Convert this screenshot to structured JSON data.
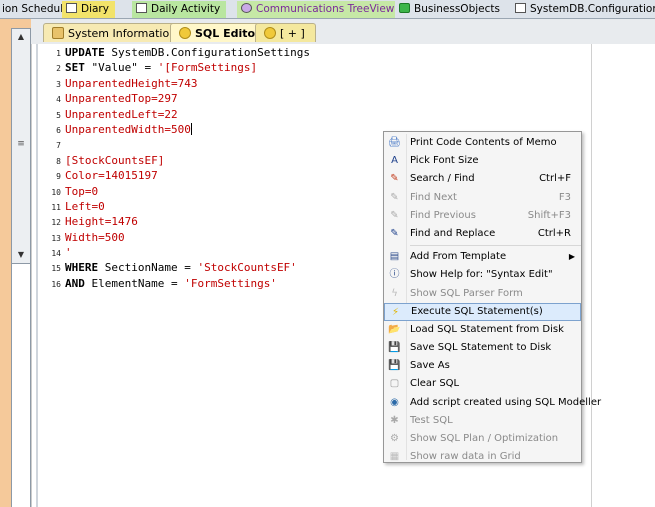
{
  "top_tabs": [
    "ion Scheduler",
    "Diary",
    "Daily Activity",
    "Communications TreeView",
    "BusinessObjects",
    "SystemDB.Configuration"
  ],
  "editor_tabs": [
    "System Information",
    "SQL Editor",
    "[ + ]"
  ],
  "code_lines": [
    {
      "n": "1",
      "parts": [
        {
          "t": "UPDATE",
          "c": "kw"
        },
        {
          "t": " SystemDB.ConfigurationSettings",
          "c": ""
        }
      ]
    },
    {
      "n": "2",
      "parts": [
        {
          "t": "SET",
          "c": "kw"
        },
        {
          "t": " \"Value\" = ",
          "c": ""
        },
        {
          "t": "'[FormSettings]",
          "c": "str"
        }
      ]
    },
    {
      "n": "3",
      "parts": [
        {
          "t": "UnparentedHeight=743",
          "c": "str"
        }
      ]
    },
    {
      "n": "4",
      "parts": [
        {
          "t": "UnparentedTop=297",
          "c": "str"
        }
      ]
    },
    {
      "n": "5",
      "parts": [
        {
          "t": "UnparentedLeft=22",
          "c": "str"
        }
      ]
    },
    {
      "n": "6",
      "parts": [
        {
          "t": "UnparentedWidth=500",
          "c": "str"
        }
      ],
      "cursor": true
    },
    {
      "n": "7",
      "parts": []
    },
    {
      "n": "8",
      "parts": [
        {
          "t": "[StockCountsEF]",
          "c": "str"
        }
      ]
    },
    {
      "n": "9",
      "parts": [
        {
          "t": "Color=14015197",
          "c": "str"
        }
      ]
    },
    {
      "n": "10",
      "parts": [
        {
          "t": "Top=0",
          "c": "str"
        }
      ]
    },
    {
      "n": "11",
      "parts": [
        {
          "t": "Left=0",
          "c": "str"
        }
      ]
    },
    {
      "n": "12",
      "parts": [
        {
          "t": "Height=1476",
          "c": "str"
        }
      ]
    },
    {
      "n": "13",
      "parts": [
        {
          "t": "Width=500",
          "c": "str"
        }
      ]
    },
    {
      "n": "14",
      "parts": [
        {
          "t": "'",
          "c": "str"
        }
      ]
    },
    {
      "n": "15",
      "parts": [
        {
          "t": "WHERE",
          "c": "kw"
        },
        {
          "t": " SectionName = ",
          "c": ""
        },
        {
          "t": "'StockCountsEF'",
          "c": "str"
        }
      ]
    },
    {
      "n": "16",
      "parts": [
        {
          "t": "AND",
          "c": "kw"
        },
        {
          "t": " ElementName = ",
          "c": ""
        },
        {
          "t": "'FormSettings'",
          "c": "str"
        }
      ]
    }
  ],
  "menu_items": [
    {
      "label": "Print Code Contents of Memo",
      "icon": "printer-icon",
      "glyph": "🖨",
      "shortcut": "",
      "disabled": false
    },
    {
      "label": "Pick Font Size",
      "icon": "font-icon",
      "glyph": "A",
      "shortcut": "",
      "disabled": false
    },
    {
      "label": "Search / Find",
      "icon": "search-icon",
      "glyph": "✎",
      "shortcut": "Ctrl+F",
      "disabled": false
    },
    {
      "label": "Find Next",
      "icon": "find-next-icon",
      "glyph": "✎",
      "shortcut": "F3",
      "disabled": true
    },
    {
      "label": "Find Previous",
      "icon": "find-previous-icon",
      "glyph": "✎",
      "shortcut": "Shift+F3",
      "disabled": true
    },
    {
      "label": "Find and Replace",
      "icon": "replace-icon",
      "glyph": "✎",
      "shortcut": "Ctrl+R",
      "disabled": false,
      "sep_after": true
    },
    {
      "label": "Add From Template",
      "icon": "template-icon",
      "glyph": "▤",
      "shortcut": "",
      "submenu": true,
      "disabled": false
    },
    {
      "label": "Show Help for: \"Syntax Edit\"",
      "icon": "help-icon",
      "glyph": "ⓘ",
      "shortcut": "",
      "disabled": false
    },
    {
      "label": "Show SQL Parser Form",
      "icon": "parser-icon",
      "glyph": "ϟ",
      "shortcut": "",
      "disabled": true
    },
    {
      "label": "Execute SQL Statement(s)",
      "icon": "execute-icon",
      "glyph": "⚡",
      "shortcut": "",
      "disabled": false,
      "highlighted": true
    },
    {
      "label": "Load SQL Statement from Disk",
      "icon": "folder-icon",
      "glyph": "📂",
      "shortcut": "",
      "disabled": false
    },
    {
      "label": "Save SQL Statement to Disk",
      "icon": "save-icon",
      "glyph": "💾",
      "shortcut": "",
      "disabled": false
    },
    {
      "label": "Save As",
      "icon": "save-as-icon",
      "glyph": "💾",
      "shortcut": "",
      "disabled": false
    },
    {
      "label": "Clear SQL",
      "icon": "clear-icon",
      "glyph": "▢",
      "shortcut": "",
      "disabled": false
    },
    {
      "label": "Add script created using SQL Modeller",
      "icon": "modeller-icon",
      "glyph": "◉",
      "shortcut": "",
      "disabled": false
    },
    {
      "label": "Test SQL",
      "icon": "bug-icon",
      "glyph": "✱",
      "shortcut": "",
      "disabled": true
    },
    {
      "label": "Show SQL Plan / Optimization",
      "icon": "plan-icon",
      "glyph": "⚙",
      "shortcut": "",
      "disabled": true
    },
    {
      "label": "Show raw data in Grid",
      "icon": "grid-icon",
      "glyph": "▦",
      "shortcut": "",
      "disabled": true
    }
  ]
}
